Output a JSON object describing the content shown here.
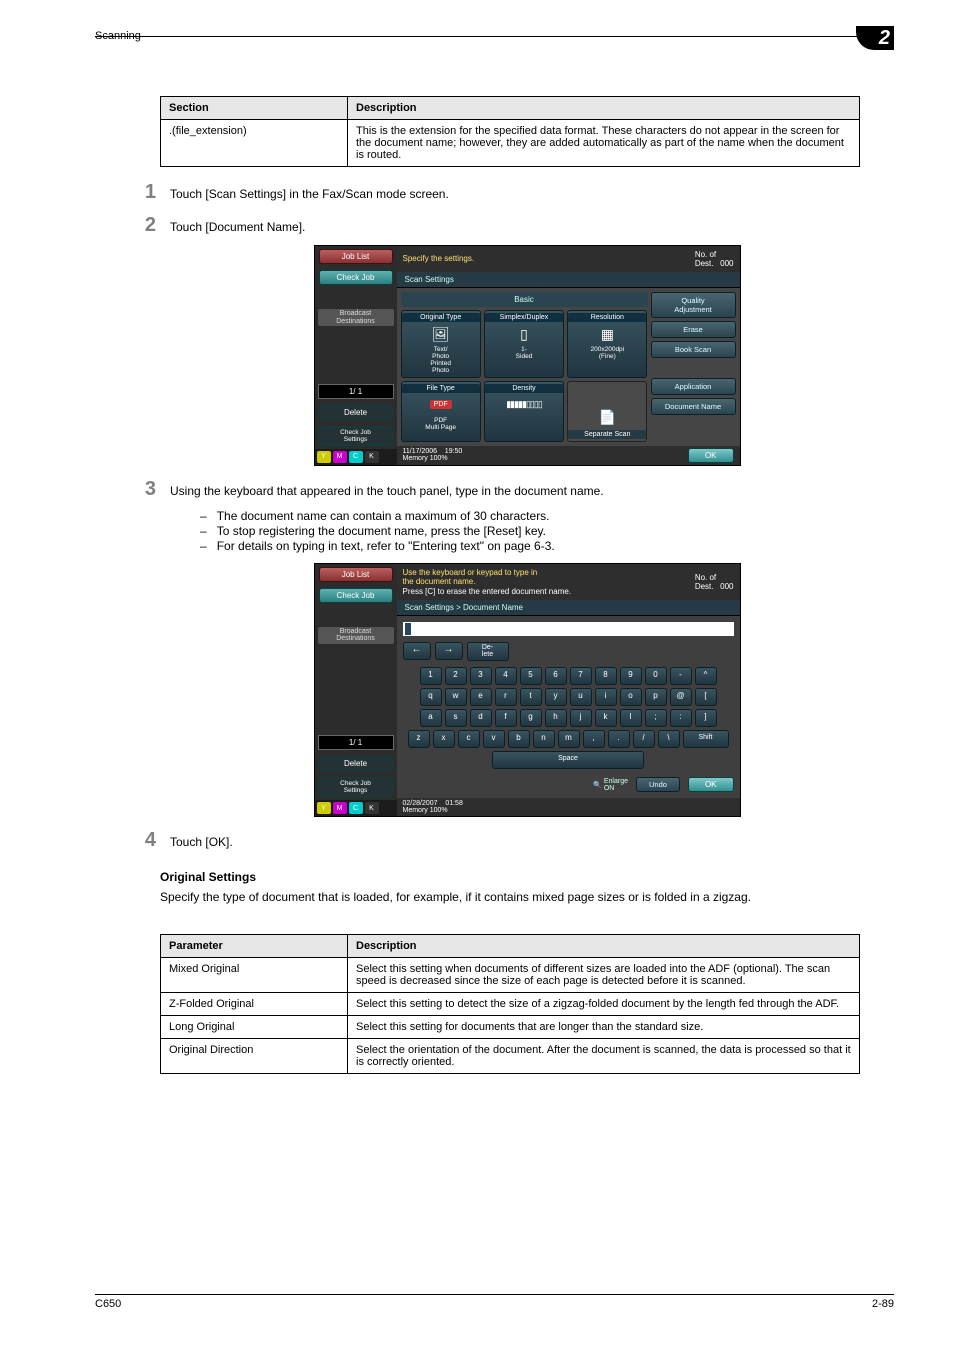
{
  "header": {
    "section": "Scanning",
    "chapter_number": "2"
  },
  "table1": {
    "cols": [
      "Section",
      "Description"
    ],
    "rows": [
      {
        "c1": ".(file_extension)",
        "c2": "This is the extension for the specified data format. These characters do not appear in the screen for the document name; however, they are added automatically as part of the name when the document is routed."
      }
    ]
  },
  "steps": {
    "s1": {
      "n": "1",
      "t": "Touch [Scan Settings] in the Fax/Scan mode screen."
    },
    "s2": {
      "n": "2",
      "t": "Touch [Document Name]."
    },
    "s3": {
      "n": "3",
      "t": "Using the keyboard that appeared in the touch panel, type in the document name."
    },
    "s4": {
      "n": "4",
      "t": "Touch [OK]."
    }
  },
  "bullets3": {
    "b1": "The document name can contain a maximum of 30 characters.",
    "b2": "To stop registering the document name, press the [Reset] key.",
    "b3": "For details on typing in text, refer to \"Entering text\" on page 6-3."
  },
  "origSettings": {
    "heading": "Original Settings",
    "intro": "Specify the type of document that is loaded, for example, if it contains mixed page sizes or is folded in a zigzag."
  },
  "table2": {
    "cols": [
      "Parameter",
      "Description"
    ],
    "rows": [
      {
        "c1": "Mixed Original",
        "c2": "Select this setting when documents of different sizes are loaded into the ADF (optional). The scan speed is decreased since the size of each page is detected before it is scanned."
      },
      {
        "c1": "Z-Folded Original",
        "c2": "Select this setting to detect the size of a zigzag-folded document by the length fed through the ADF."
      },
      {
        "c1": "Long Original",
        "c2": "Select this setting for documents that are longer than the standard size."
      },
      {
        "c1": "Original Direction",
        "c2": "Select the orientation of the document. After the document is scanned, the data is processed so that it is correctly oriented."
      }
    ]
  },
  "footer": {
    "left": "C650",
    "right": "2-89"
  },
  "panel1": {
    "msg": "Specify the settings.",
    "dest": "No. of  000",
    "bread": "Scan Settings",
    "tab": "Basic",
    "sidebar": {
      "jobList": "Job List",
      "checkJob": "Check Job",
      "broadcast": "Broadcast\nDestinations",
      "pager": "1/  1",
      "delete": "Delete",
      "checkSettings": "Check Job\nSettings"
    },
    "right": {
      "quality": "Quality\nAdjustment",
      "erase": "Erase",
      "book": "Book Scan",
      "app": "Application",
      "docname": "Document Name"
    },
    "opts": {
      "origtype_h": "Original Type",
      "origtype_s": "Text/\nPhoto\nPrinted\nPhoto",
      "simdup_h": "Simplex/Duplex",
      "simdup_s": "1-\nSided",
      "res_h": "Resolution",
      "res_s": "200x200dpi\n(Fine)",
      "ftype_h": "File Type",
      "ftype_s": "PDF\nMulti Page",
      "density_h": "Density",
      "sep_h": "Separate Scan"
    },
    "footer": {
      "date": "11/17/2006",
      "time": "19:50",
      "mem": "Memory     100%",
      "ok": "OK"
    }
  },
  "panel2": {
    "msg1": "Use the keyboard or keypad to type in",
    "msg2": "the document name.",
    "msg3": "Press [C] to erase the entered document name.",
    "dest": "No. of  000",
    "bread": "Scan Settings > Document Name",
    "sidebar": {
      "jobList": "Job List",
      "checkJob": "Check Job",
      "broadcast": "Broadcast\nDestinations",
      "pager": "1/  1",
      "delete": "Delete",
      "checkSettings": "Check Job\nSettings"
    },
    "kbd": {
      "del": "De-\nlete",
      "row1": [
        "1",
        "2",
        "3",
        "4",
        "5",
        "6",
        "7",
        "8",
        "9",
        "0",
        "-",
        "^"
      ],
      "row2": [
        "q",
        "w",
        "e",
        "r",
        "t",
        "y",
        "u",
        "i",
        "o",
        "p",
        "@",
        "["
      ],
      "row3": [
        "a",
        "s",
        "d",
        "f",
        "g",
        "h",
        "j",
        "k",
        "l",
        ";",
        ":",
        "]"
      ],
      "row4": [
        "z",
        "x",
        "c",
        "v",
        "b",
        "n",
        "m",
        ",",
        ".",
        "/",
        "\\"
      ],
      "shift": "Shift",
      "space": "Space",
      "enlarge": "Enlarge\nON",
      "undo": "Undo",
      "ok": "OK"
    },
    "footer": {
      "date": "02/28/2007",
      "time": "01:58",
      "mem": "Memory     100%"
    }
  }
}
